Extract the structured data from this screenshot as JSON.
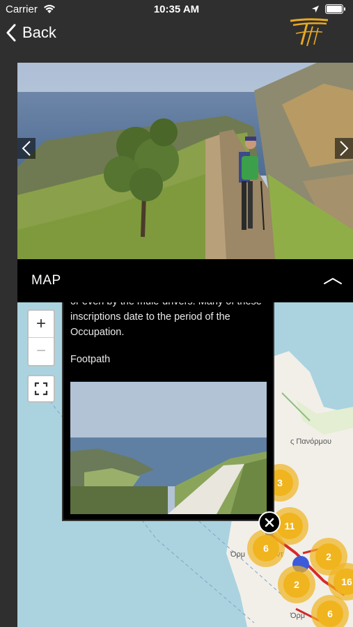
{
  "status_bar": {
    "carrier": "Carrier",
    "time": "10:35 AM"
  },
  "nav": {
    "back_label": "Back"
  },
  "gallery": {
    "prev_icon": "chevron-left-icon",
    "next_icon": "chevron-right-icon"
  },
  "map_section": {
    "title": "MAP"
  },
  "map": {
    "zoom_in": "+",
    "zoom_out": "−",
    "popup": {
      "text": "or even by the mule-drivers. Many of these inscriptions date to the period of the Occupation.",
      "label": "Footpath"
    },
    "place_labels": [
      "ς Πανόρμου",
      "Όρμ",
      "ντ",
      "Όρμ"
    ],
    "clusters": [
      "3",
      "11",
      "6",
      "2",
      "2",
      "16",
      "6"
    ]
  },
  "colors": {
    "accent": "#f0b41e",
    "water": "#aad3df",
    "land": "#f2efe9",
    "route": "#d62a2a"
  }
}
